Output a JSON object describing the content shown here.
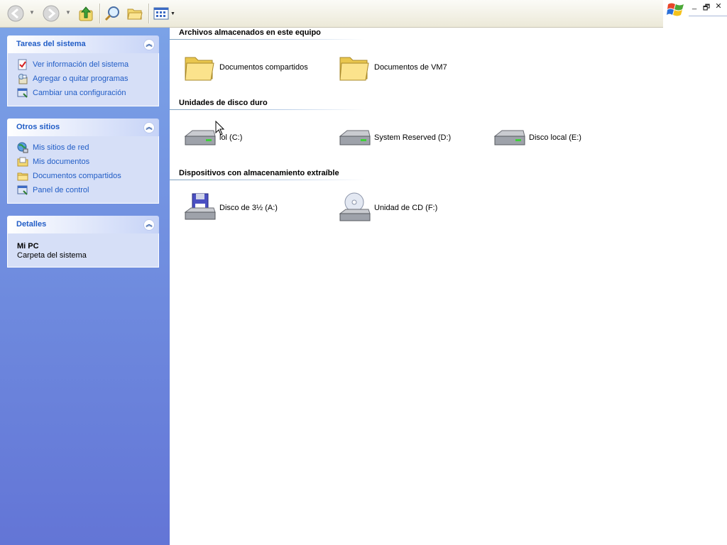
{
  "toolbar": {
    "buttons": [
      {
        "name": "back-button",
        "icon": "back-arrow-icon"
      },
      {
        "name": "forward-button",
        "icon": "forward-arrow-icon"
      },
      {
        "name": "up-button",
        "icon": "folder-up-icon"
      },
      {
        "name": "search-button",
        "icon": "search-icon"
      },
      {
        "name": "folders-button",
        "icon": "folders-icon"
      },
      {
        "name": "views-button",
        "icon": "views-icon"
      }
    ]
  },
  "window": {
    "minimize": "_",
    "restore": "🗗",
    "close": "✕"
  },
  "taskpane": {
    "system_tasks": {
      "title": "Tareas del sistema",
      "items": [
        {
          "label": "Ver información del sistema",
          "icon": "system-info-icon"
        },
        {
          "label": "Agregar o quitar programas",
          "icon": "add-remove-programs-icon"
        },
        {
          "label": "Cambiar una configuración",
          "icon": "control-panel-icon"
        }
      ]
    },
    "other_places": {
      "title": "Otros sitios",
      "items": [
        {
          "label": "Mis sitios de red",
          "icon": "network-places-icon"
        },
        {
          "label": "Mis documentos",
          "icon": "my-documents-icon"
        },
        {
          "label": "Documentos compartidos",
          "icon": "shared-folder-icon"
        },
        {
          "label": "Panel de control",
          "icon": "control-panel-icon"
        }
      ]
    },
    "details": {
      "title": "Detalles",
      "name": "Mi PC",
      "type": "Carpeta del sistema"
    }
  },
  "content": {
    "groups": [
      {
        "title": "Archivos almacenados en este equipo",
        "items": [
          {
            "label": "Documentos compartidos",
            "icon": "folder-icon"
          },
          {
            "label": "Documentos de VM7",
            "icon": "folder-icon"
          }
        ]
      },
      {
        "title": "Unidades de disco duro",
        "items": [
          {
            "label": "lol (C:)",
            "icon": "hard-disk-icon"
          },
          {
            "label": "System Reserved (D:)",
            "icon": "hard-disk-icon"
          },
          {
            "label": "Disco local (E:)",
            "icon": "hard-disk-icon"
          }
        ]
      },
      {
        "title": "Dispositivos con almacenamiento extraíble",
        "items": [
          {
            "label": "Disco de 3½ (A:)",
            "icon": "floppy-drive-icon"
          },
          {
            "label": "Unidad de CD (F:)",
            "icon": "cd-drive-icon"
          }
        ]
      }
    ]
  }
}
